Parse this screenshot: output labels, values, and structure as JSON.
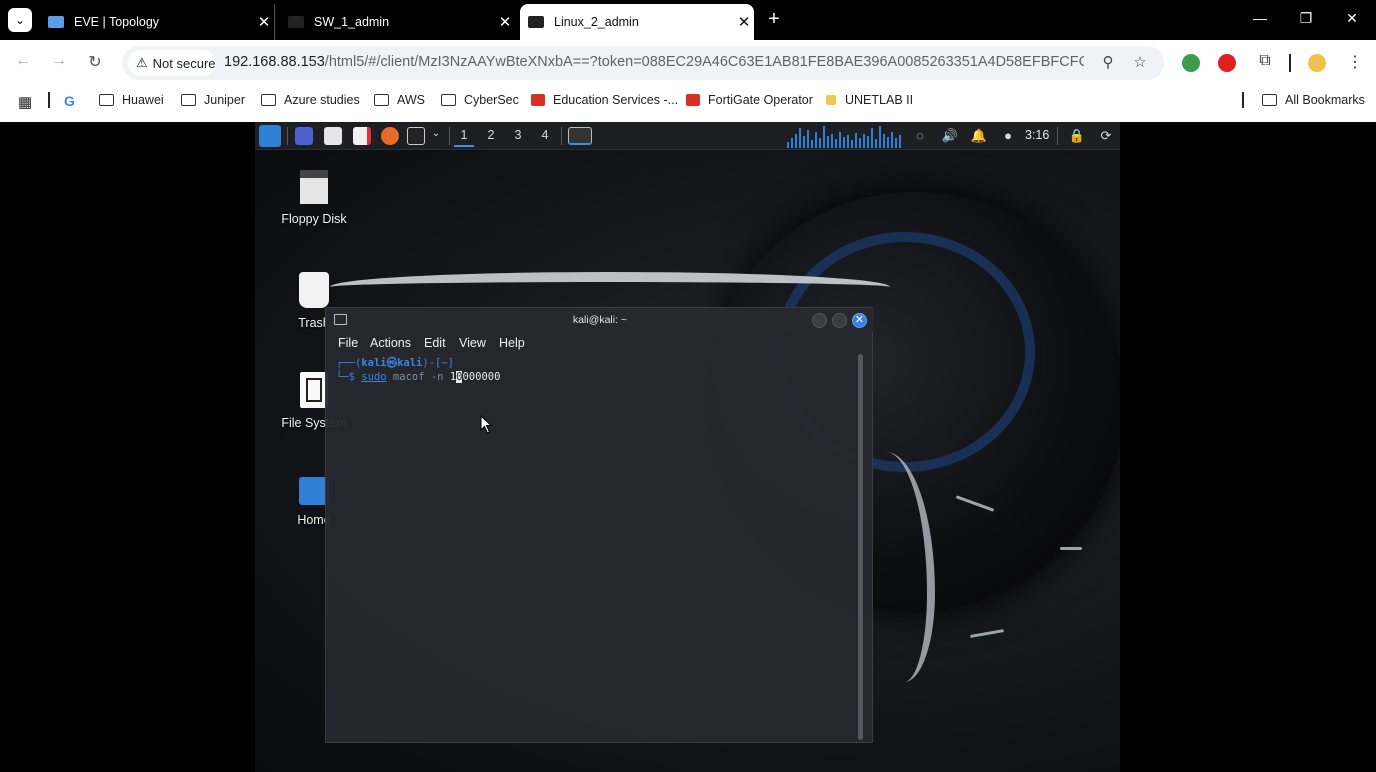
{
  "browser": {
    "tabs": [
      {
        "title": "EVE | Topology",
        "active": false
      },
      {
        "title": "SW_1_admin",
        "active": false
      },
      {
        "title": "Linux_2_admin",
        "active": true
      }
    ],
    "security_chip": "Not secure",
    "url_host": "192.168.88.153",
    "url_rest": "/html5/#/client/MzI3NzAAYwBteXNxbA==?token=088EC29A46C63E1AB81FE8BAE396A0085263351A4D58EFBFCFCB8E...",
    "bookmarks": [
      "Huawei",
      "Juniper",
      "Azure studies",
      "AWS",
      "CyberSec",
      "Education Services -...",
      "FortiGate Operator",
      "UNETLAB II"
    ],
    "all_bookmarks": "All Bookmarks"
  },
  "desktop": {
    "workspaces": [
      "1",
      "2",
      "3",
      "4"
    ],
    "clock": "3:16",
    "icons": [
      {
        "label": "Floppy Disk",
        "icon": "floppy-disk-icon"
      },
      {
        "label": "Trash",
        "icon": "trash-icon"
      },
      {
        "label": "File System",
        "icon": "drive-icon"
      },
      {
        "label": "Home",
        "icon": "home-folder-icon"
      }
    ],
    "accent": "#3b84e3"
  },
  "terminal": {
    "title": "kali@kali: ~",
    "menu": [
      "File",
      "Actions",
      "Edit",
      "View",
      "Help"
    ],
    "prompt_open": "┌──(",
    "prompt_user": "kali",
    "prompt_at": "㉿",
    "prompt_host": "kali",
    "prompt_dir": ")-[~]",
    "prompt_close": "└─$",
    "cmd": "sudo",
    "args": "macof -n",
    "num_before_cursor": "1",
    "num_cursor": "0",
    "num_after_cursor": "000000"
  }
}
